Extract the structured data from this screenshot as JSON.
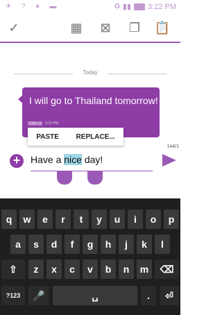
{
  "status_bar": {
    "signal": "G",
    "time": "3:22 PM"
  },
  "toolbar": {
    "done_icon": "check-icon",
    "icons": [
      "grid-icon",
      "attach-icon",
      "copy-icon",
      "clipboard-icon"
    ]
  },
  "conversation": {
    "date_divider": "Today",
    "message_text": "I will go to Thailand tomorrow!",
    "message_meta_name": "Chin...e",
    "message_meta_time": "3:15 PM"
  },
  "context_menu": {
    "paste_label": "PASTE",
    "replace_label": "REPLACE..."
  },
  "composer": {
    "char_count": "144/1",
    "text_before": "Have a ",
    "text_selected": "nice",
    "text_after": " day!"
  },
  "keyboard": {
    "row1": [
      "q",
      "w",
      "e",
      "r",
      "t",
      "y",
      "u",
      "i",
      "o",
      "p"
    ],
    "row2": [
      "a",
      "s",
      "d",
      "f",
      "g",
      "h",
      "j",
      "k",
      "l"
    ],
    "row3": [
      "z",
      "x",
      "c",
      "v",
      "b",
      "n",
      "m"
    ],
    "symbols_label": "?123",
    "period_label": "."
  },
  "colors": {
    "accent": "#8e3da6",
    "keyboard_bg": "#1f1f1f",
    "key_bg": "#3a3a3a"
  }
}
